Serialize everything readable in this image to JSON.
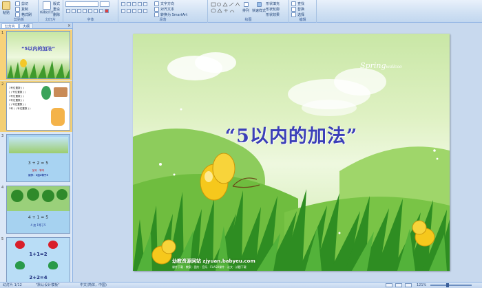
{
  "ribbon": {
    "clipboard": {
      "label": "剪贴板",
      "paste": "粘贴",
      "cut": "剪切",
      "copy": "复制",
      "format_painter": "格式刷"
    },
    "slides": {
      "label": "幻灯片",
      "new_slide": "新建幻灯片",
      "layout": "版式",
      "reset": "重设",
      "delete": "删除"
    },
    "font": {
      "label": "字体"
    },
    "paragraph": {
      "label": "段落",
      "text_direction": "文字方向",
      "align_text": "对齐文本",
      "smartart": "转换为 SmartArt"
    },
    "drawing": {
      "label": "绘图",
      "arrange": "排列",
      "quick_styles": "快速样式",
      "shape_fill": "形状填充",
      "shape_outline": "形状轮廓",
      "shape_effects": "形状效果"
    },
    "editing": {
      "label": "编辑",
      "find": "查找",
      "replace": "替换",
      "select": "选择"
    }
  },
  "panel": {
    "tab_slides": "幻灯片",
    "tab_outline": "大纲",
    "close": "×"
  },
  "thumbnails": [
    {
      "num": "1",
      "title": "“5以内的加法”"
    },
    {
      "num": "2",
      "lines": [
        "1号位置数 (   )",
        "(  ) 号位置数 (   )",
        "1号位置数 (   )",
        "3号位置数 (   )",
        "(  ) 号位置数 (   )",
        "3号 (   ) 号位置数 (   )"
      ]
    },
    {
      "num": "3",
      "equation": "3 + 2 = 5",
      "caption1": "加号 · 等号",
      "caption2": "读作：3加2等于5"
    },
    {
      "num": "4",
      "equation": "4 + 1 = 5",
      "caption": "4 加 1等于5"
    },
    {
      "num": "5",
      "equation1": "1+1=2",
      "equation2": "2+2=4"
    }
  ],
  "slide": {
    "title": "“5以内的加法”",
    "spring_text": "Spring",
    "spring_sub": "wallcoo",
    "footer_site": "幼教资源网站 zjyuan.babyeu.com",
    "footer_sub": "课件下载 · 教案 · 图片 · 音乐 · FLASH课件 · 论文 · 试题下载"
  },
  "status": {
    "slide_count": "幻灯片 1/12",
    "theme": "\"默认设计模板\"",
    "language": "中文(简体，中国)",
    "zoom": "121%"
  }
}
